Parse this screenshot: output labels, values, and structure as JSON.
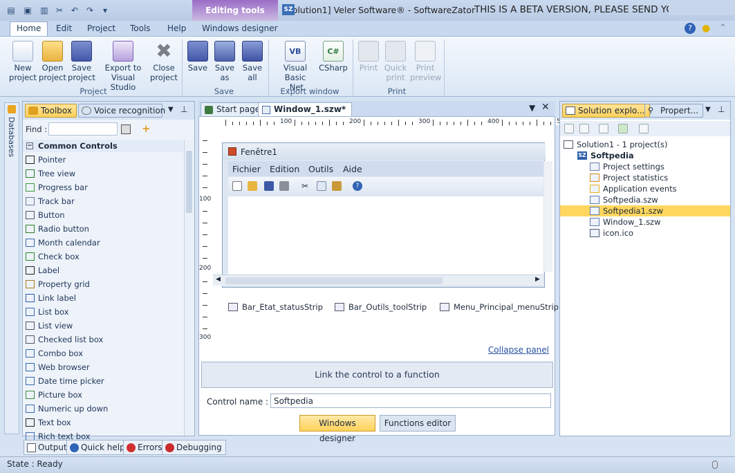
{
  "titlebar": {
    "context_tab": "Editing tools",
    "window_title": "[Solution1] Veler Software® - SoftwareZator",
    "beta_notice": "THIS IS A BETA VERSION, PLEASE SEND YOUR FEEDBACKS :"
  },
  "ribbon_tabs": [
    "Home",
    "Edit",
    "Project",
    "Tools",
    "Help",
    "Windows designer"
  ],
  "ribbon": {
    "buttons": [
      {
        "label": "New\nproject",
        "icon": "new-project-icon"
      },
      {
        "label": "Open\nproject",
        "icon": "open-project-icon"
      },
      {
        "label": "Save\nproject",
        "icon": "save-project-icon"
      },
      {
        "label": "Export to\nVisual Studio",
        "icon": "visual-studio-icon"
      },
      {
        "label": "Close\nproject",
        "icon": "close-project-icon"
      },
      {
        "label": "Save",
        "icon": "save-icon"
      },
      {
        "label": "Save\nas",
        "icon": "save-as-icon"
      },
      {
        "label": "Save\nall",
        "icon": "save-all-icon"
      },
      {
        "label": "Visual Basic\n.Net",
        "icon": "vb-icon"
      },
      {
        "label": "CSharp",
        "icon": "csharp-icon"
      },
      {
        "label": "Print",
        "icon": "print-icon"
      },
      {
        "label": "Quick\nprint",
        "icon": "quick-print-icon"
      },
      {
        "label": "Print\npreview",
        "icon": "print-preview-icon"
      }
    ],
    "groups": [
      "Project",
      "Save",
      "Export window",
      "Print"
    ]
  },
  "left_strip": {
    "label": "Databases"
  },
  "toolbox": {
    "tabs": [
      "Toolbox",
      "Voice recognition"
    ],
    "find_label": "Find :",
    "category": "Common Controls",
    "items": [
      "Pointer",
      "Tree view",
      "Progress bar",
      "Track bar",
      "Button",
      "Radio button",
      "Month calendar",
      "Check box",
      "Label",
      "Property grid",
      "Link label",
      "List box",
      "List view",
      "Checked list box",
      "Combo box",
      "Web browser",
      "Date time picker",
      "Picture box",
      "Numeric up down",
      "Text box",
      "Rich text box"
    ]
  },
  "document": {
    "tabs": [
      "Start page",
      "Window_1.szw*"
    ],
    "ruler_h": [
      "100",
      "200",
      "300",
      "400",
      "5"
    ],
    "ruler_v": [
      "100",
      "200",
      "300"
    ],
    "form_title": "Fenêtre1",
    "form_menu": [
      "Fichier",
      "Edition",
      "Outils",
      "Aide"
    ],
    "components": [
      "Bar_Etat_statusStrip",
      "Bar_Outils_toolStrip",
      "Menu_Principal_menuStrip"
    ],
    "collapse_label": "Collapse panel",
    "link_button": "Link the control to a function",
    "control_name_label": "Control name :",
    "control_name_value": "Softpedia",
    "windows_designer_btn": "Windows designer",
    "functions_editor_btn": "Functions editor"
  },
  "solution": {
    "tabs": [
      "Solution explo...",
      "Propert..."
    ],
    "root": "Solution1 - 1 project(s)",
    "project": "Softpedia",
    "items": [
      "Project settings",
      "Project statistics",
      "Application events",
      "Softpedia.szw",
      "Softpedia1.szw",
      "Window_1.szw",
      "icon.ico"
    ],
    "selected": "Softpedia1.szw"
  },
  "bottom_tabs": [
    "Output",
    "Quick help",
    "Errors",
    "Debugging"
  ],
  "status": {
    "text": "State :  Ready"
  }
}
